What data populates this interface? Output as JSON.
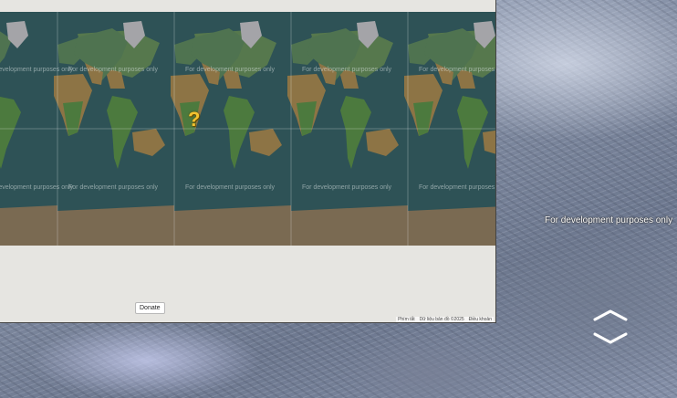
{
  "streetview": {
    "watermark": "For development purposes only",
    "nav": {
      "up_icon": "chevron-up",
      "down_icon": "chevron-down"
    }
  },
  "map": {
    "watermark": "For development purposes only",
    "marker_symbol": "?",
    "donate_label": "Donate",
    "attribution": {
      "shortcuts": "Phím tắt",
      "data": "Dữ liệu bản đồ ©2025",
      "terms": "Điều khoản"
    },
    "colors": {
      "ocean": "#2e5256",
      "land": "#4f7350",
      "marker": "#f2c230",
      "panel": "#e6e5e1"
    }
  }
}
